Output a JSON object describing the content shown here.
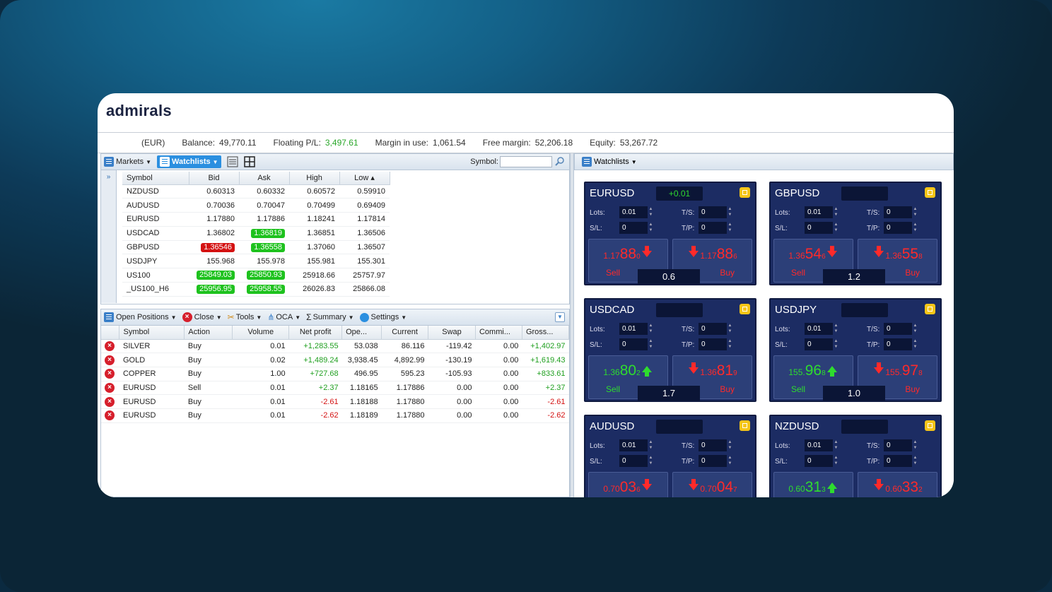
{
  "brand": "admirals",
  "account": {
    "currency": "(EUR)",
    "balance_label": "Balance:",
    "balance": "49,770.11",
    "floating_label": "Floating P/L:",
    "floating": "3,497.61",
    "margin_label": "Margin in use:",
    "margin": "1,061.54",
    "free_label": "Free margin:",
    "free": "52,206.18",
    "equity_label": "Equity:",
    "equity": "53,267.72"
  },
  "market_toolbar": {
    "markets": "Markets",
    "watchlists": "Watchlists",
    "symbol_label": "Symbol:",
    "symbol_value": ""
  },
  "watch_table": {
    "headers": [
      "Symbol",
      "Bid",
      "Ask",
      "High",
      "Low ▴"
    ],
    "rows": [
      {
        "symbol": "NZDUSD",
        "bid": "0.60313",
        "ask": "0.60332",
        "high": "0.60572",
        "low": "0.59910"
      },
      {
        "symbol": "AUDUSD",
        "bid": "0.70036",
        "ask": "0.70047",
        "high": "0.70499",
        "low": "0.69409"
      },
      {
        "symbol": "EURUSD",
        "bid": "1.17880",
        "ask": "1.17886",
        "high": "1.18241",
        "low": "1.17814"
      },
      {
        "symbol": "USDCAD",
        "bid": "1.36802",
        "ask": "1.36819",
        "high": "1.36851",
        "low": "1.36506"
      },
      {
        "symbol": "GBPUSD",
        "bid": "1.36546",
        "ask": "1.36558",
        "high": "1.37060",
        "low": "1.36507"
      },
      {
        "symbol": "USDJPY",
        "bid": "155.968",
        "ask": "155.978",
        "high": "155.981",
        "low": "155.301"
      },
      {
        "symbol": "US100",
        "bid": "25849.03",
        "ask": "25850.93",
        "high": "25918.66",
        "low": "25757.97"
      },
      {
        "symbol": "_US100_H6",
        "bid": "25956.95",
        "ask": "25958.55",
        "high": "26026.83",
        "low": "25866.08"
      }
    ]
  },
  "positions_toolbar": {
    "open_positions": "Open Positions",
    "close": "Close",
    "tools": "Tools",
    "oca": "OCA",
    "summary": "Summary",
    "settings": "Settings"
  },
  "positions_table": {
    "headers": [
      "Symbol",
      "Action",
      "Volume",
      "Net profit",
      "Ope...",
      "Current",
      "Swap",
      "Commi...",
      "Gross..."
    ],
    "rows": [
      {
        "symbol": "SILVER",
        "action": "Buy",
        "volume": "0.01",
        "net": "+1,283.55",
        "open": "53.038",
        "current": "86.116",
        "swap": "-119.42",
        "comm": "0.00",
        "gross": "+1,402.97"
      },
      {
        "symbol": "GOLD",
        "action": "Buy",
        "volume": "0.02",
        "net": "+1,489.24",
        "open": "3,938.45",
        "current": "4,892.99",
        "swap": "-130.19",
        "comm": "0.00",
        "gross": "+1,619.43"
      },
      {
        "symbol": "COPPER",
        "action": "Buy",
        "volume": "1.00",
        "net": "+727.68",
        "open": "496.95",
        "current": "595.23",
        "swap": "-105.93",
        "comm": "0.00",
        "gross": "+833.61"
      },
      {
        "symbol": "EURUSD",
        "action": "Sell",
        "volume": "0.01",
        "net": "+2.37",
        "open": "1.18165",
        "current": "1.17886",
        "swap": "0.00",
        "comm": "0.00",
        "gross": "+2.37"
      },
      {
        "symbol": "EURUSD",
        "action": "Buy",
        "volume": "0.01",
        "net": "-2.61",
        "open": "1.18188",
        "current": "1.17880",
        "swap": "0.00",
        "comm": "0.00",
        "gross": "-2.61"
      },
      {
        "symbol": "EURUSD",
        "action": "Buy",
        "volume": "0.01",
        "net": "-2.62",
        "open": "1.18189",
        "current": "1.17880",
        "swap": "0.00",
        "comm": "0.00",
        "gross": "-2.62"
      }
    ]
  },
  "right_toolbar": {
    "watchlists": "Watchlists"
  },
  "tile_labels": {
    "lots": "Lots:",
    "sl": "S/L:",
    "ts": "T/S:",
    "tp": "T/P:",
    "sell": "Sell",
    "buy": "Buy"
  },
  "tiles": [
    {
      "symbol": "EURUSD",
      "change": "+0.01",
      "lots": "0.01",
      "sl": "0",
      "ts": "0",
      "tp": "0",
      "sell": {
        "small": "1.17",
        "big": "88",
        "pip": "0",
        "dir": "red"
      },
      "buy": {
        "small": "1.17",
        "big": "88",
        "pip": "6",
        "dir": "red"
      },
      "spread": "0.6"
    },
    {
      "symbol": "GBPUSD",
      "change": "",
      "lots": "0.01",
      "sl": "0",
      "ts": "0",
      "tp": "0",
      "sell": {
        "small": "1.36",
        "big": "54",
        "pip": "6",
        "dir": "red"
      },
      "buy": {
        "small": "1.36",
        "big": "55",
        "pip": "8",
        "dir": "red"
      },
      "spread": "1.2"
    },
    {
      "symbol": "USDCAD",
      "change": "",
      "lots": "0.01",
      "sl": "0",
      "ts": "0",
      "tp": "0",
      "sell": {
        "small": "1.36",
        "big": "80",
        "pip": "2",
        "dir": "green"
      },
      "buy": {
        "small": "1.36",
        "big": "81",
        "pip": "9",
        "dir": "red"
      },
      "spread": "1.7"
    },
    {
      "symbol": "USDJPY",
      "change": "",
      "lots": "0.01",
      "sl": "0",
      "ts": "0",
      "tp": "0",
      "sell": {
        "small": "155.",
        "big": "96",
        "pip": "8",
        "dir": "green"
      },
      "buy": {
        "small": "155.",
        "big": "97",
        "pip": "8",
        "dir": "red"
      },
      "spread": "1.0"
    },
    {
      "symbol": "AUDUSD",
      "change": "",
      "lots": "0.01",
      "sl": "0",
      "ts": "0",
      "tp": "0",
      "sell": {
        "small": "0.70",
        "big": "03",
        "pip": "6",
        "dir": "red"
      },
      "buy": {
        "small": "0.70",
        "big": "04",
        "pip": "7",
        "dir": "red"
      },
      "spread": ""
    },
    {
      "symbol": "NZDUSD",
      "change": "",
      "lots": "0.01",
      "sl": "0",
      "ts": "0",
      "tp": "0",
      "sell": {
        "small": "0.60",
        "big": "31",
        "pip": "3",
        "dir": "green"
      },
      "buy": {
        "small": "0.60",
        "big": "33",
        "pip": "2",
        "dir": "red"
      },
      "spread": ""
    }
  ],
  "colors": {
    "tile_bg": "#1c2c63",
    "up": "#1ec21e",
    "down": "#d41212",
    "accent": "#2b8fe0"
  }
}
